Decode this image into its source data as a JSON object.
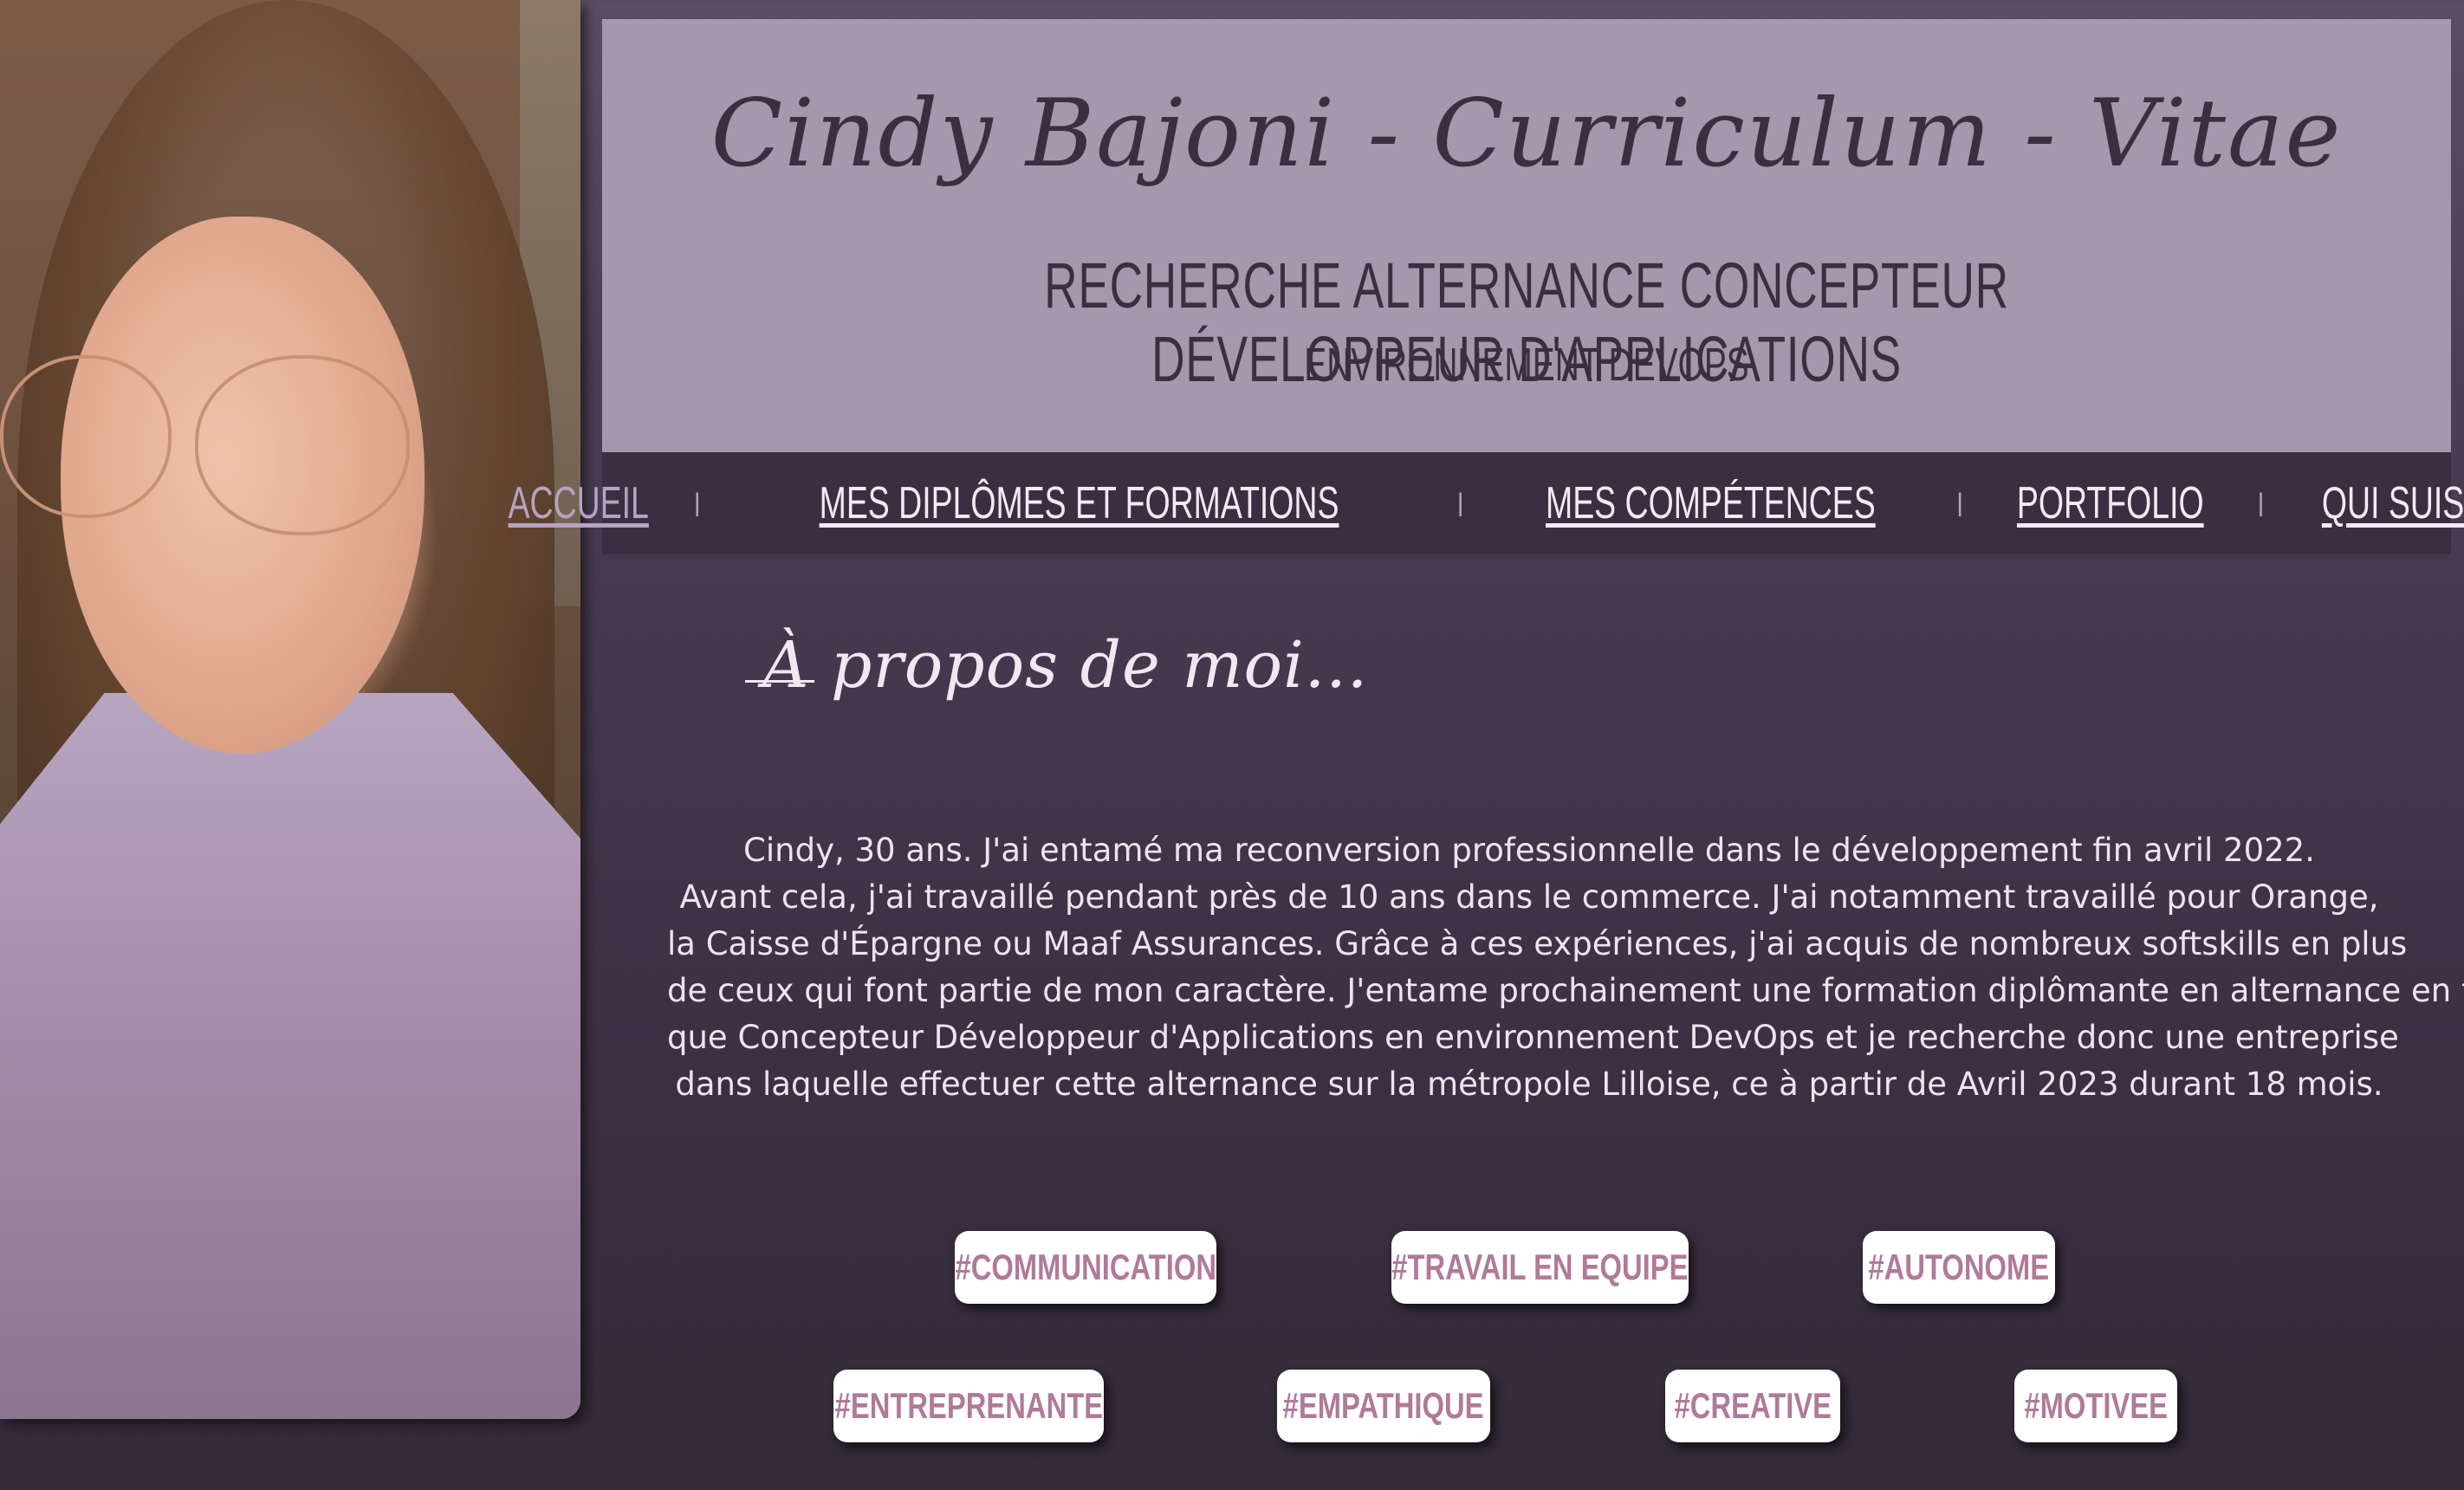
{
  "header": {
    "title": "Cindy Bajoni - Curriculum - Vitae",
    "subtitle": "Recherche alternance concepteur développeur d'applications",
    "subtitle2": "environnement DevOps"
  },
  "nav": {
    "items": [
      {
        "label": "Accueil",
        "active": true
      },
      {
        "label": "Mes diplômes et formations",
        "active": false
      },
      {
        "label": "Mes compétences",
        "active": false
      },
      {
        "label": "Portfolio",
        "active": false
      },
      {
        "label": "Qui suis-je?",
        "active": false
      }
    ],
    "separator": "|"
  },
  "about": {
    "heading": "À propos de moi...",
    "lines": [
      "Cindy, 30 ans. J'ai entamé ma reconversion professionnelle dans le développement fin avril 2022.",
      "Avant cela, j'ai travaillé pendant près de 10 ans dans le commerce. J'ai notamment travaillé pour Orange,",
      "la Caisse d'Épargne ou Maaf Assurances. Grâce à ces expériences, j'ai acquis de nombreux softskills en plus",
      "de ceux qui font partie de mon caractère. J'entame prochainement une formation diplômante en alternance en tant",
      "que Concepteur Développeur d'Applications en environnement DevOps et je recherche donc une entreprise",
      "dans laquelle effectuer cette alternance sur la métropole Lilloise, ce à partir de Avril 2023 durant 18 mois."
    ]
  },
  "tags": {
    "row1": [
      "#COMMUNICATION",
      "#TRAVAIL EN EQUIPE",
      "#AUTONOME"
    ],
    "row2": [
      "#ENTREPRENANTE",
      "#EMPATHIQUE",
      "#CREATIVE",
      "#MOTIVEE"
    ]
  },
  "colors": {
    "header_bg": "#a597ac",
    "nav_bg": "#3a2f40",
    "nav_active": "#b6a3c2",
    "tag_text": "#b07a9a",
    "page_bg_top": "#5a4d63",
    "page_bg_bottom": "#332a39"
  }
}
